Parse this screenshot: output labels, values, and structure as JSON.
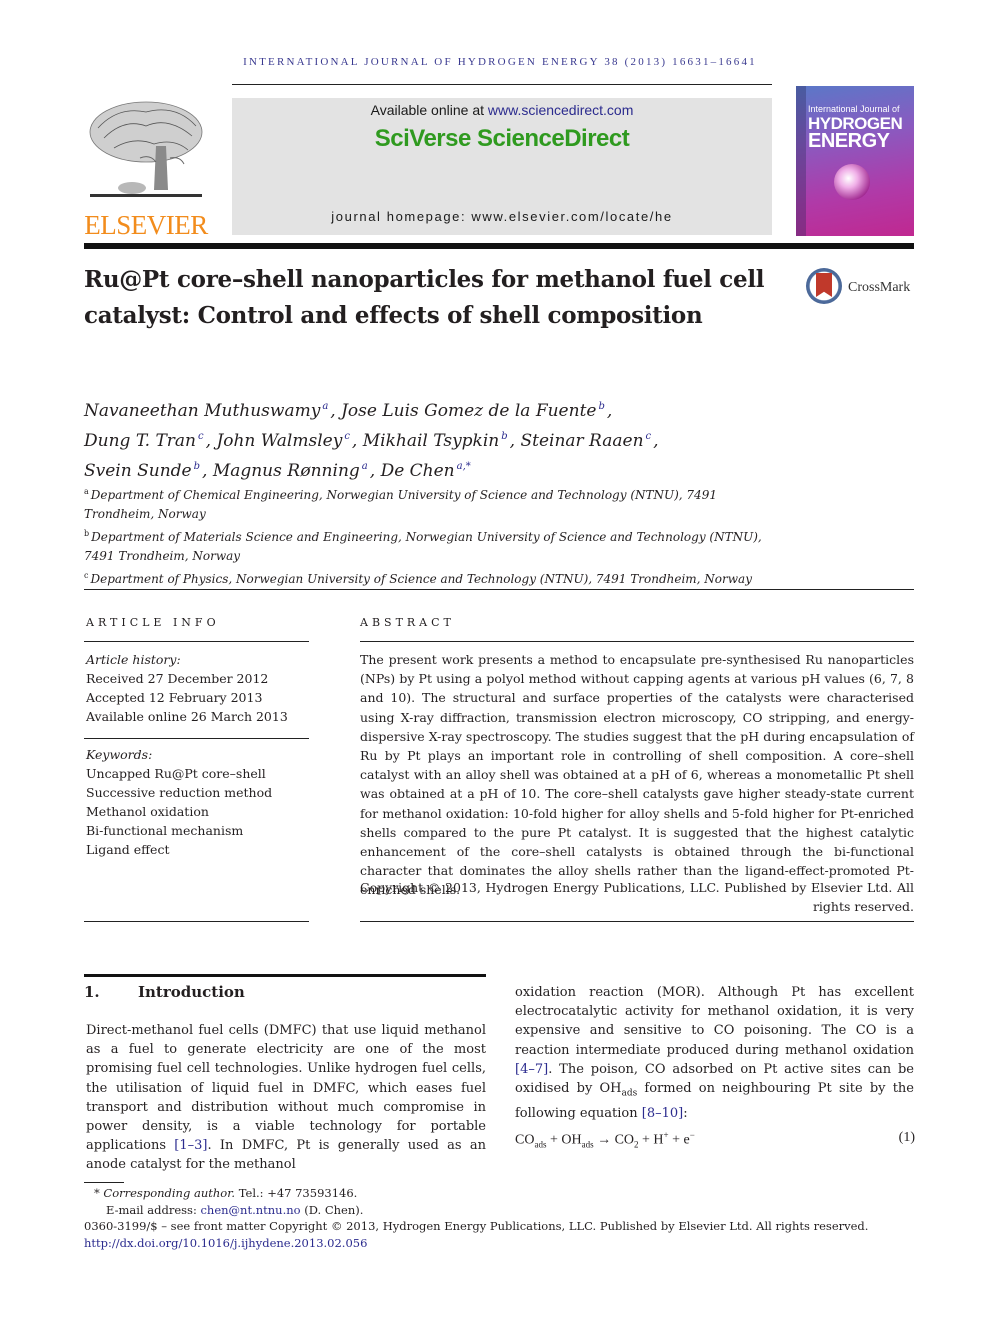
{
  "header": {
    "running_head": "INTERNATIONAL JOURNAL OF HYDROGEN ENERGY 38 (2013) 16631–16641",
    "publisher_logo_text": "ELSEVIER",
    "available_online_prefix": "Available online at ",
    "available_online_link": "www.sciencedirect.com",
    "platform_name": "SciVerse ScienceDirect",
    "journal_homepage": "journal homepage: www.elsevier.com/locate/he",
    "cover": {
      "line1": "International Journal of",
      "line2": "HYDROGEN",
      "line3": "ENERGY"
    },
    "colors": {
      "elsevier_orange": "#f28c1c",
      "sciencedirect_green": "#2f9a1f",
      "link_blue": "#2b2b8e",
      "banner_gray": "#e3e3e3"
    }
  },
  "article": {
    "title": "Ru@Pt core–shell nanoparticles for methanol fuel cell catalyst: Control and effects of shell composition",
    "crossmark_label": "CrossMark",
    "authors": [
      {
        "name": "Navaneethan Muthuswamy",
        "affil": "a"
      },
      {
        "name": "Jose Luis Gomez de la Fuente",
        "affil": "b"
      },
      {
        "name": "Dung T. Tran",
        "affil": "c"
      },
      {
        "name": "John Walmsley",
        "affil": "c"
      },
      {
        "name": "Mikhail Tsypkin",
        "affil": "b"
      },
      {
        "name": "Steinar Raaen",
        "affil": "c"
      },
      {
        "name": "Svein Sunde",
        "affil": "b"
      },
      {
        "name": "Magnus Rønning",
        "affil": "a"
      },
      {
        "name": "De Chen",
        "affil": "a,*"
      }
    ],
    "affiliations": [
      {
        "key": "a",
        "text": "Department of Chemical Engineering, Norwegian University of Science and Technology (NTNU), 7491 Trondheim, Norway"
      },
      {
        "key": "b",
        "text": "Department of Materials Science and Engineering, Norwegian University of Science and Technology (NTNU), 7491 Trondheim, Norway"
      },
      {
        "key": "c",
        "text": "Department of Physics, Norwegian University of Science and Technology (NTNU), 7491 Trondheim, Norway"
      }
    ]
  },
  "article_info": {
    "label": "ARTICLE INFO",
    "history_label": "Article history:",
    "history": [
      "Received 27 December 2012",
      "Accepted 12 February 2013",
      "Available online 26 March 2013"
    ],
    "keywords_label": "Keywords:",
    "keywords": [
      "Uncapped Ru@Pt core–shell",
      "Successive reduction method",
      "Methanol oxidation",
      "Bi-functional mechanism",
      "Ligand effect"
    ]
  },
  "abstract": {
    "label": "ABSTRACT",
    "text": "The present work presents a method to encapsulate pre-synthesised Ru nanoparticles (NPs) by Pt using a polyol method without capping agents at various pH values (6, 7, 8 and 10). The structural and surface properties of the catalysts were characterised using X-ray diffraction, transmission electron microscopy, CO stripping, and energy-dispersive X-ray spectroscopy. The studies suggest that the pH during encapsulation of Ru by Pt plays an important role in controlling of shell composition. A core–shell catalyst with an alloy shell was obtained at a pH of 6, whereas a monometallic Pt shell was obtained at a pH of 10. The core–shell catalysts gave higher steady-state current for methanol oxidation: 10-fold higher for alloy shells and 5-fold higher for Pt-enriched shells compared to the pure Pt catalyst. It is suggested that the highest catalytic enhancement of the core–shell catalysts is obtained through the bi-functional character that dominates the alloy shells rather than the ligand-effect-promoted Pt-enriched shells.",
    "copyright": "Copyright © 2013, Hydrogen Energy Publications, LLC. Published by Elsevier Ltd. All rights reserved."
  },
  "introduction": {
    "number": "1.",
    "heading": "Introduction",
    "left_col": [
      {
        "t": "Direct-methanol fuel cells (DMFC) that use liquid methanol as a fuel to generate electricity are one of the most promising fuel cell technologies. Unlike hydrogen fuel cells, the utilisation of liquid fuel in DMFC, which eases fuel transport and distribution without much compromise in power density, is a viable technology for portable applications "
      },
      {
        "ref": "[1–3]"
      },
      {
        "t": ". In DMFC, Pt is generally used as an anode catalyst for the methanol"
      }
    ],
    "right_col": [
      {
        "t": "oxidation reaction (MOR). Although Pt has excellent electrocatalytic activity for methanol oxidation, it is very expensive and sensitive to CO poisoning. The CO is a reaction intermediate produced during methanol oxidation "
      },
      {
        "ref": "[4–7]"
      },
      {
        "t": ". The poison, CO adsorbed on Pt active sites can be oxidised by OH"
      },
      {
        "sub": "ads"
      },
      {
        "t": " formed on neighbouring Pt site by the following equation "
      },
      {
        "ref": "[8–10]"
      },
      {
        "t": ":"
      }
    ],
    "equation": {
      "terms": [
        {
          "t": "CO"
        },
        {
          "sub": "ads"
        },
        {
          "t": " + OH"
        },
        {
          "sub": "ads"
        },
        {
          "t": " → CO"
        },
        {
          "sub": "2"
        },
        {
          "t": " + H"
        },
        {
          "sup": "+"
        },
        {
          "t": " + e"
        },
        {
          "sup": "−"
        }
      ],
      "number": "(1)"
    }
  },
  "footnotes": {
    "corresponding_mark": "*",
    "corresponding_label": "Corresponding author.",
    "tel": " Tel.: +47 73593146.",
    "email_label": "E-mail address: ",
    "email": "chen@nt.ntnu.no",
    "email_suffix": " (D. Chen).",
    "issn_line": "0360-3199/$ – see front matter Copyright © 2013, Hydrogen Energy Publications, LLC. Published by Elsevier Ltd. All rights reserved.",
    "doi": "http://dx.doi.org/10.1016/j.ijhydene.2013.02.056"
  }
}
